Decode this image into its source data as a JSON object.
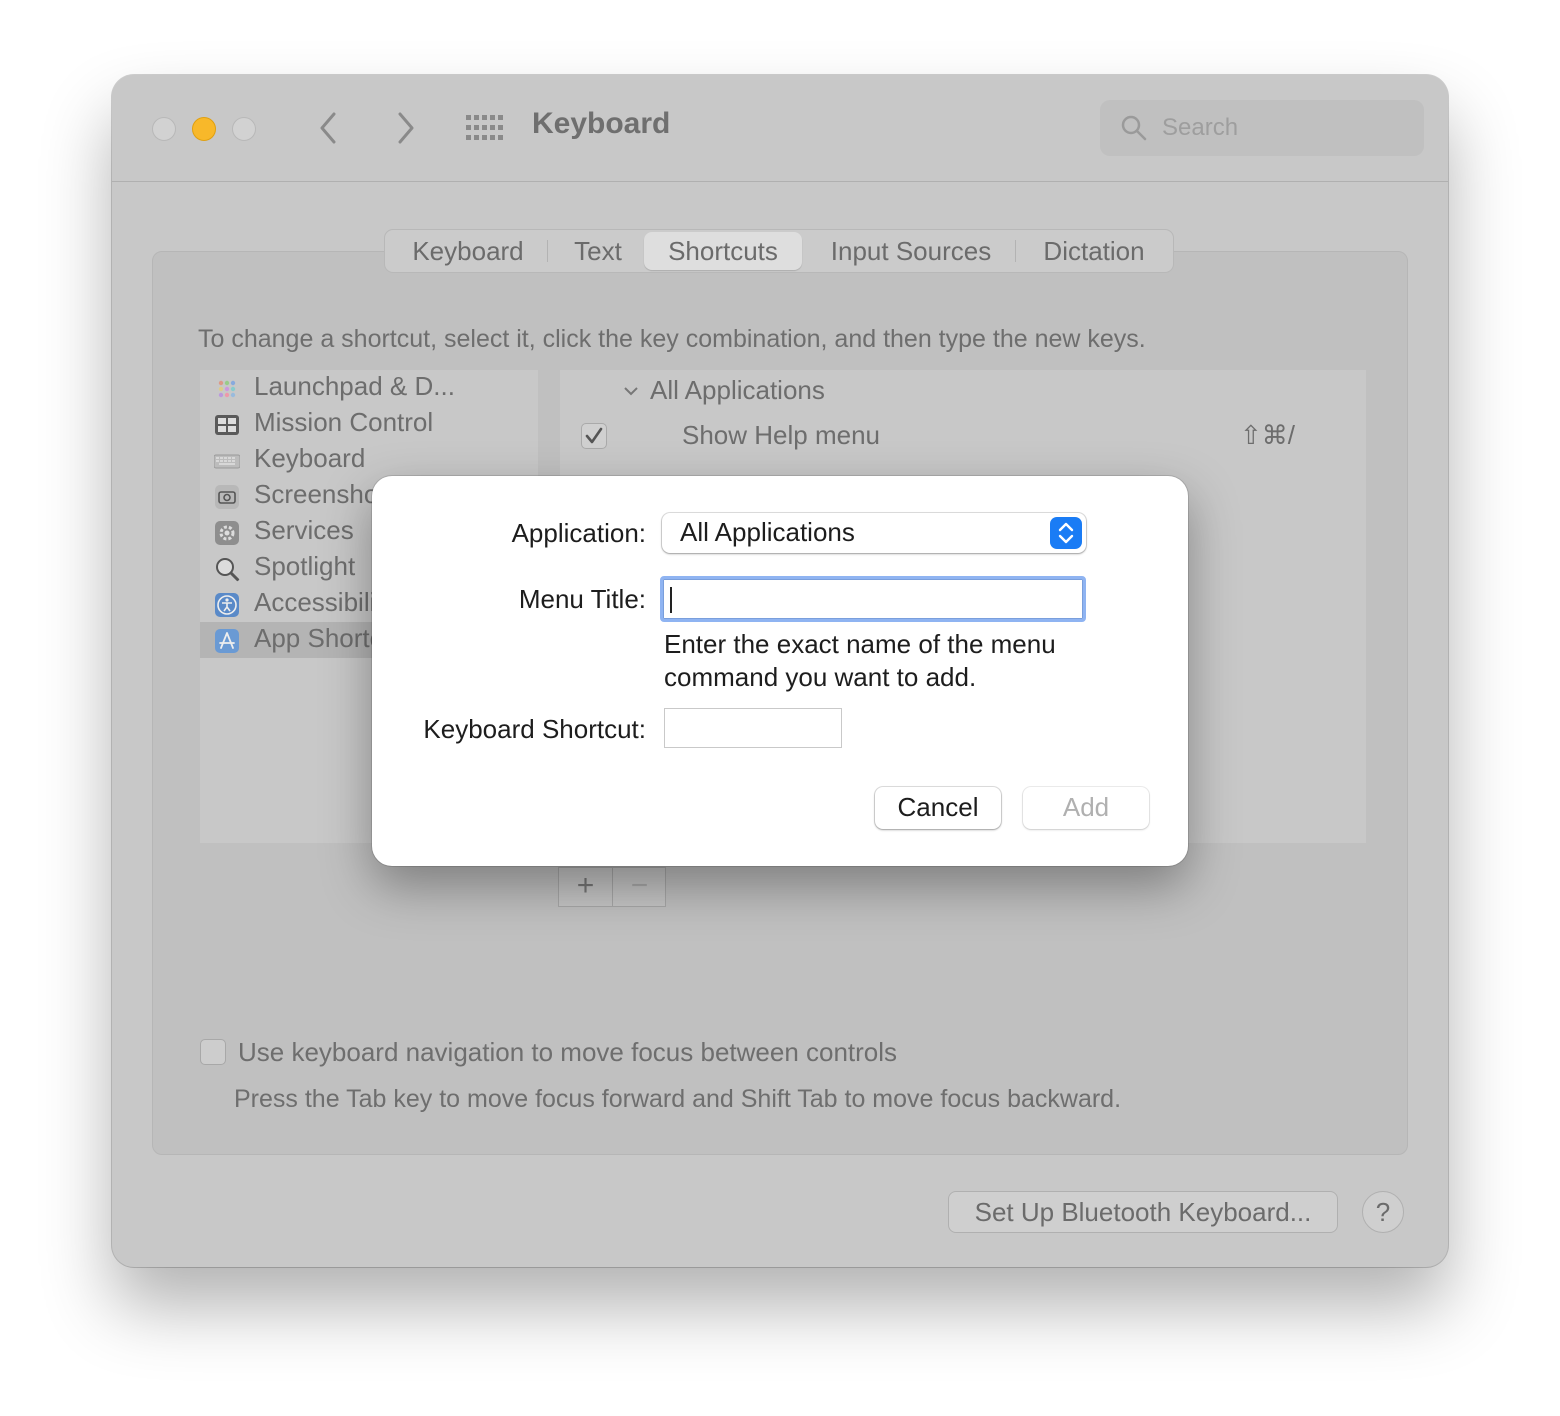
{
  "window": {
    "title": "Keyboard",
    "search_placeholder": "Search"
  },
  "tabs": [
    {
      "label": "Keyboard"
    },
    {
      "label": "Text"
    },
    {
      "label": "Shortcuts",
      "active": true
    },
    {
      "label": "Input Sources"
    },
    {
      "label": "Dictation"
    }
  ],
  "instructions": "To change a shortcut, select it, click the key combination, and then type the new keys.",
  "categories": [
    {
      "label": "Launchpad & D...",
      "icon": "launchpad-icon"
    },
    {
      "label": "Mission Control",
      "icon": "mission-control-icon"
    },
    {
      "label": "Keyboard",
      "icon": "keyboard-icon"
    },
    {
      "label": "Screenshots",
      "icon": "screenshot-icon"
    },
    {
      "label": "Services",
      "icon": "gear-icon"
    },
    {
      "label": "Spotlight",
      "icon": "magnifier-icon"
    },
    {
      "label": "Accessibility",
      "icon": "accessibility-icon"
    },
    {
      "label": "App Shortcuts",
      "icon": "app-store-icon",
      "selected": true
    }
  ],
  "shortcuts": {
    "group_label": "All Applications",
    "rows": [
      {
        "label": "Show Help menu",
        "checked": true,
        "shortcut": "⇧⌘/"
      }
    ],
    "add_label": "+",
    "remove_label": "−"
  },
  "keyboard_nav": {
    "label": "Use keyboard navigation to move focus between controls",
    "help": "Press the Tab key to move focus forward and Shift Tab to move focus backward.",
    "checked": false
  },
  "footer": {
    "bluetooth_button": "Set Up Bluetooth Keyboard...",
    "help_button": "?"
  },
  "sheet": {
    "application_label": "Application:",
    "application_value": "All Applications",
    "menu_title_label": "Menu Title:",
    "menu_title_value": "",
    "hint": "Enter the exact name of the menu command you want to add.",
    "shortcut_label": "Keyboard Shortcut:",
    "cancel_label": "Cancel",
    "add_label": "Add"
  },
  "colors": {
    "accent": "#1a7cf5",
    "focus_ring": "#8fb4f2",
    "minimize_light": "#f8b82a"
  }
}
